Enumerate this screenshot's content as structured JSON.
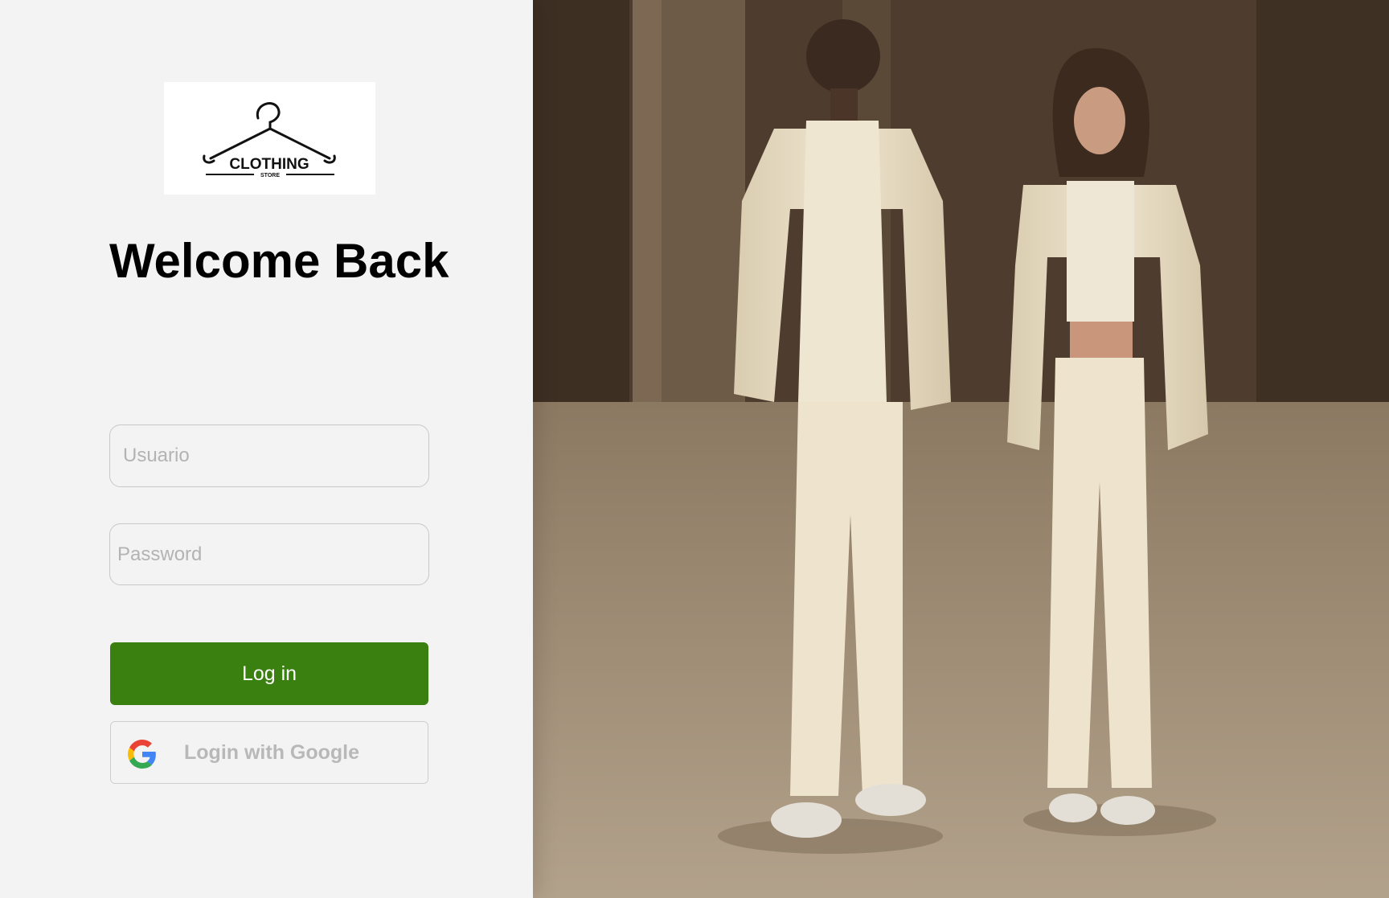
{
  "brand": {
    "logo_main": "CLOTHING",
    "logo_sub": "STORE"
  },
  "heading": "Welcome Back",
  "form": {
    "username_placeholder": "Usuario",
    "password_placeholder": "Password",
    "login_label": "Log in",
    "google_label": "Login with Google"
  },
  "colors": {
    "login_button": "#3a8011",
    "panel_background": "#f3f3f3"
  },
  "icons": [
    "hanger-icon",
    "google-icon"
  ],
  "hero_image": "photo of two models wearing cream hoodies, jackets and trousers in a concrete space"
}
